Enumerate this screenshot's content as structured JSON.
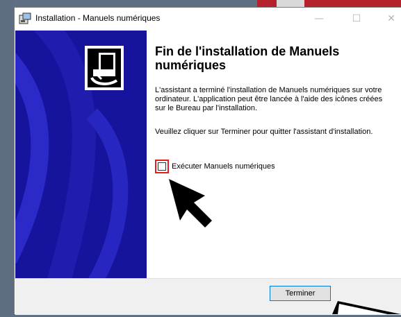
{
  "window": {
    "title": "Installation - Manuels numériques"
  },
  "content": {
    "heading": "Fin de l'installation de Manuels numériques",
    "paragraph1": "L'assistant a terminé l'installation de Manuels numériques sur votre ordinateur. L'application peut être lancée à l'aide des icônes créées sur le Bureau par l'installation.",
    "paragraph2": "Veuillez cliquer sur Terminer pour quitter l'assistant d'installation.",
    "run_checkbox": {
      "label": "Exécuter Manuels numériques",
      "checked": false
    }
  },
  "footer": {
    "finish_label": "Terminer"
  },
  "colors": {
    "sidepanel": "#16139d",
    "highlight": "#e02020",
    "button_border": "#0078d7"
  },
  "icons": [
    "installer-icon",
    "minimize-icon",
    "maximize-icon",
    "close-icon",
    "setup-logo-icon",
    "pointer-arrow-icon"
  ]
}
